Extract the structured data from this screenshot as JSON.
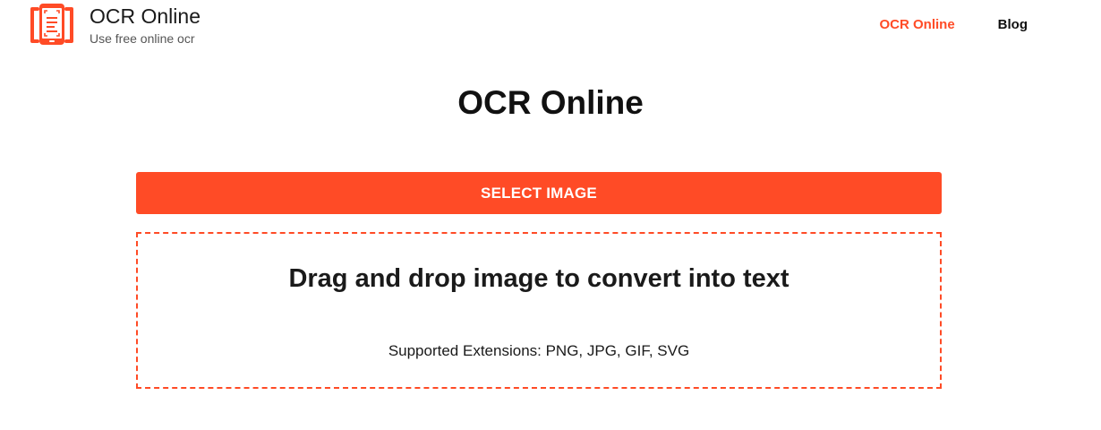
{
  "header": {
    "brand": {
      "title": "OCR Online",
      "subtitle": "Use free online ocr",
      "logo_icon": "ocr-scan-phone-icon"
    },
    "nav": {
      "items": [
        {
          "label": "OCR Online",
          "active": true
        },
        {
          "label": "Blog",
          "active": false
        }
      ]
    }
  },
  "main": {
    "title": "OCR Online",
    "select_button_label": "SELECT IMAGE",
    "drop_zone": {
      "title": "Drag and drop image to convert into text",
      "supported": "Supported Extensions: PNG, JPG, GIF, SVG"
    }
  },
  "colors": {
    "accent": "#ff4b26",
    "text": "#1a1a1a",
    "subtle_text": "#555555",
    "background": "#ffffff"
  }
}
